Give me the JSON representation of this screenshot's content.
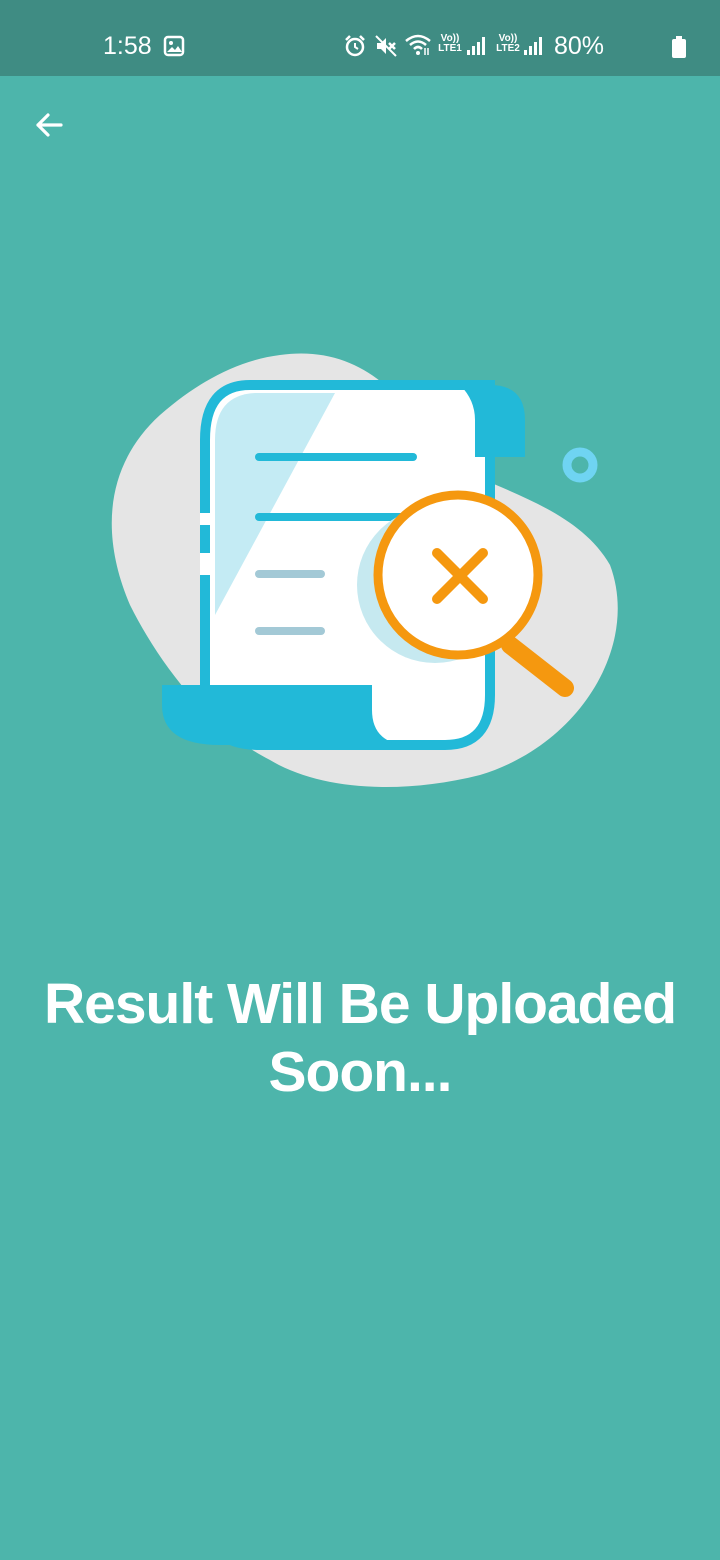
{
  "status_bar": {
    "time": "1:58",
    "lte1": "Vo)) LTE1",
    "lte2": "Vo)) LTE2",
    "battery": "80%"
  },
  "nav": {
    "back_icon": "arrow-left-icon"
  },
  "illustration": {
    "icon": "document-search-error-illustration"
  },
  "message": "Result Will Be Uploaded Soon...",
  "colors": {
    "background": "#4db5ab",
    "status_bar": "#3f8c83",
    "accent_blue": "#22b9d8",
    "accent_orange": "#f5980f"
  }
}
